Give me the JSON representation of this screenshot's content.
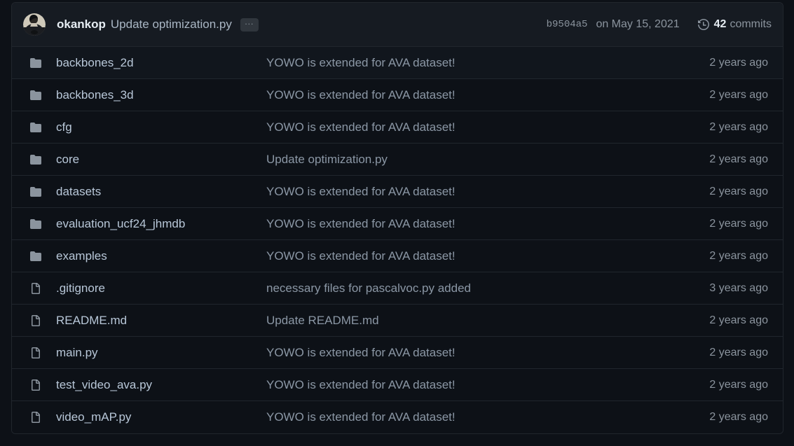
{
  "header": {
    "avatar_icon": "user-avatar",
    "author": "okankop",
    "message": "Update optimization.py",
    "ellipsis_label": "...",
    "sha": "b9504a5",
    "date": "on May 15, 2021",
    "history_icon": "history-clock-icon",
    "commits_count": "42",
    "commits_word": "commits"
  },
  "colors": {
    "page_bg": "#0d1117",
    "header_bg": "#161b22",
    "row_bg": "#0d1117",
    "row_alt_bg": "#11161d",
    "border": "#21262d",
    "link": "#b8c7d8",
    "muted": "#8b949e",
    "accent_text": "#e6edf3",
    "folder_icon": "#8b949e",
    "file_icon": "#8b949e"
  },
  "files": [
    {
      "icon": "folder-icon",
      "type": "folder",
      "name": "backbones_2d",
      "commit": "YOWO is extended for AVA dataset!",
      "age": "2 years ago"
    },
    {
      "icon": "folder-icon",
      "type": "folder",
      "name": "backbones_3d",
      "commit": "YOWO is extended for AVA dataset!",
      "age": "2 years ago"
    },
    {
      "icon": "folder-icon",
      "type": "folder",
      "name": "cfg",
      "commit": "YOWO is extended for AVA dataset!",
      "age": "2 years ago"
    },
    {
      "icon": "folder-icon",
      "type": "folder",
      "name": "core",
      "commit": "Update optimization.py",
      "age": "2 years ago"
    },
    {
      "icon": "folder-icon",
      "type": "folder",
      "name": "datasets",
      "commit": "YOWO is extended for AVA dataset!",
      "age": "2 years ago"
    },
    {
      "icon": "folder-icon",
      "type": "folder",
      "name": "evaluation_ucf24_jhmdb",
      "commit": "YOWO is extended for AVA dataset!",
      "age": "2 years ago"
    },
    {
      "icon": "folder-icon",
      "type": "folder",
      "name": "examples",
      "commit": "YOWO is extended for AVA dataset!",
      "age": "2 years ago"
    },
    {
      "icon": "file-icon",
      "type": "file",
      "name": ".gitignore",
      "commit": "necessary files for pascalvoc.py added",
      "age": "3 years ago"
    },
    {
      "icon": "file-icon",
      "type": "file",
      "name": "README.md",
      "commit": "Update README.md",
      "age": "2 years ago"
    },
    {
      "icon": "file-icon",
      "type": "file",
      "name": "main.py",
      "commit": "YOWO is extended for AVA dataset!",
      "age": "2 years ago"
    },
    {
      "icon": "file-icon",
      "type": "file",
      "name": "test_video_ava.py",
      "commit": "YOWO is extended for AVA dataset!",
      "age": "2 years ago"
    },
    {
      "icon": "file-icon",
      "type": "file",
      "name": "video_mAP.py",
      "commit": "YOWO is extended for AVA dataset!",
      "age": "2 years ago"
    }
  ]
}
